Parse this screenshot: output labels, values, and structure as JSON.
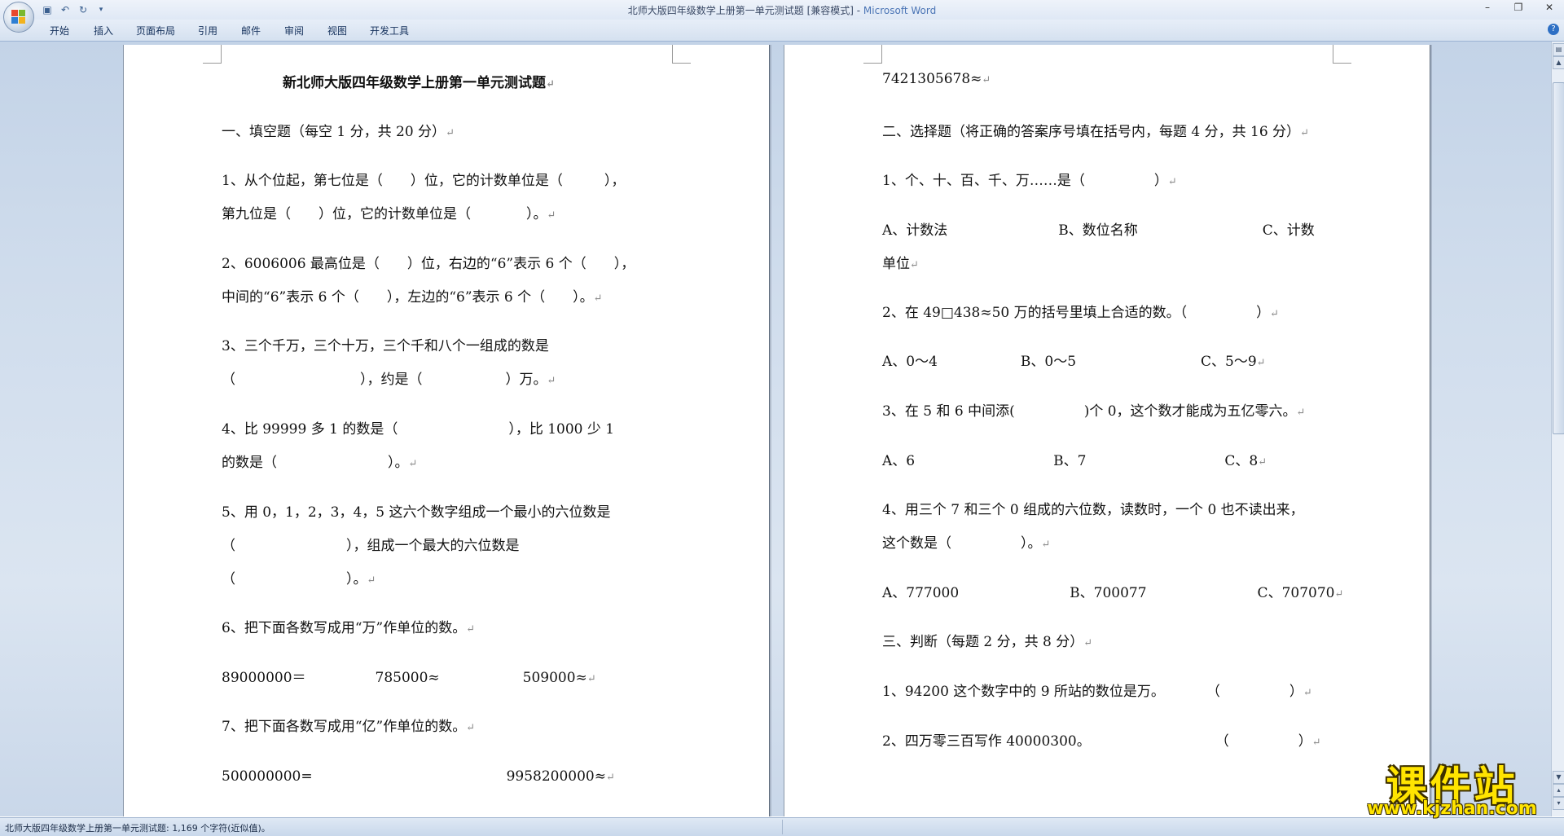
{
  "window": {
    "title": "北师大版四年级数学上册第一单元测试题 [兼容模式] - ",
    "app_name": "Microsoft Word"
  },
  "ribbon": {
    "tabs": [
      "开始",
      "插入",
      "页面布局",
      "引用",
      "邮件",
      "审阅",
      "视图",
      "开发工具"
    ]
  },
  "document": {
    "left_page": {
      "title": "新北师大版四年级数学上册第一单元测试题",
      "lines": [
        "一、填空题（每空 1 分，共 20 分）",
        "1、从个位起，第七位是（　　）位，它的计数单位是（　　　），",
        "第九位是（　　）位，它的计数单位是（　　　　）。",
        "2、6006006 最高位是（　　）位，右边的“6”表示 6 个（　　），",
        "中间的“6”表示 6 个（　　），左边的“6”表示 6 个（　　）。",
        "3、三个千万，三个十万，三个千和八个一组成的数是",
        "（　　　　　　　　　），约是（　　　　　　）万。",
        "4、比 99999 多 1 的数是（　　　　　　　　），比 1000 少 1",
        "的数是（　　　　　　　　）。",
        "5、用 0，1，2，3，4，5 这六个数字组成一个最小的六位数是",
        "（　　　　　　　　），组成一个最大的六位数是",
        "（　　　　　　　　）。",
        "6、把下面各数写成用“万”作单位的数。",
        "89000000＝　　　　　785000≈　　　　　　509000≈",
        "7、把下面各数写成用“亿”作单位的数。",
        "500000000=　　　　　　　　　　　　　　9958200000≈"
      ]
    },
    "right_page": {
      "lines": [
        "7421305678≈",
        "二、选择题（将正确的答案序号填在括号内，每题 4 分，共 16 分）",
        "1、个、十、百、千、万……是（　　　　　）",
        "A、计数法　　　　　　　　B、数位名称　　　　　　　　　C、计数",
        "单位",
        "2、在 49□438≈50 万的括号里填上合适的数。（　　　　　）",
        "A、0～4　　　　　　B、0～5　　　　　　　　　C、5～9",
        "3、在 5 和 6 中间添(　　　　　)个 0，这个数才能成为五亿零六。",
        "A、6　　　　　　　　　　B、7　　　　　　　　　　C、8",
        "4、用三个 7 和三个 0 组成的六位数，读数时，一个 0 也不读出来，",
        "这个数是（　　　　　）。",
        "A、777000　　　　　　　　B、700077　　　　　　　　C、707070",
        "三、判断（每题 2 分，共 8 分）",
        "1、94200 这个数字中的 9 所站的数位是万。　　　　（　　　　　）",
        "2、四万零三百写作 40000300。　　　　　　　　　　（　　　　　）"
      ]
    }
  },
  "statusbar": {
    "text": "北师大版四年级数学上册第一单元测试题: 1,169 个字符(近似值)。"
  },
  "watermark": {
    "big": "课件站",
    "small": "www.kjzhan.com"
  }
}
